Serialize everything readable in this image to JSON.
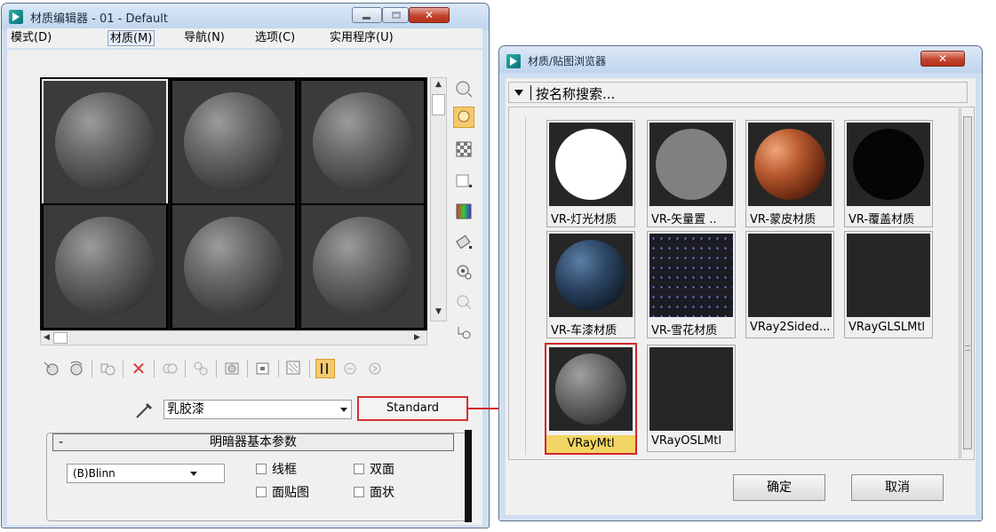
{
  "material_editor": {
    "title": "材质编辑器 - 01 - Default",
    "menu": [
      "模式(D)",
      "材质(M)",
      "导航(N)",
      "选项(C)",
      "实用程序(U)"
    ],
    "material_name": "乳胶漆",
    "material_type": "Standard",
    "rollout_title": "明暗器基本参数",
    "rollout_collapse": "-",
    "shader": "(B)Blinn",
    "checkboxes": [
      "线框",
      "双面",
      "面贴图",
      "面状"
    ]
  },
  "browser": {
    "title": "材质/贴图浏览器",
    "search_placeholder": "按名称搜索...",
    "tiles": [
      {
        "label": "VR-灯光材质",
        "icon": "white-sphere"
      },
      {
        "label": "VR-矢量置 ..",
        "icon": "gray-sphere"
      },
      {
        "label": "VR-蒙皮材质",
        "icon": "copper-sphere"
      },
      {
        "label": "VR-覆盖材质",
        "icon": "black-sphere"
      },
      {
        "label": "VR-车漆材质",
        "icon": "car-paint-sphere"
      },
      {
        "label": "VR-雪花材质",
        "icon": "flakes"
      },
      {
        "label": "VRay2Sided...",
        "icon": "blank"
      },
      {
        "label": "VRayGLSLMtl",
        "icon": "blank"
      },
      {
        "label": "VRayMtl",
        "icon": "gray-sphere-shaded"
      },
      {
        "label": "VRayOSLMtl",
        "icon": "blank"
      }
    ],
    "ok_label": "确定",
    "cancel_label": "取消"
  },
  "colors": {
    "highlight_red": "#d3252a",
    "selection_yellow": "#f2d564",
    "active_tool": "#f5c96b"
  }
}
